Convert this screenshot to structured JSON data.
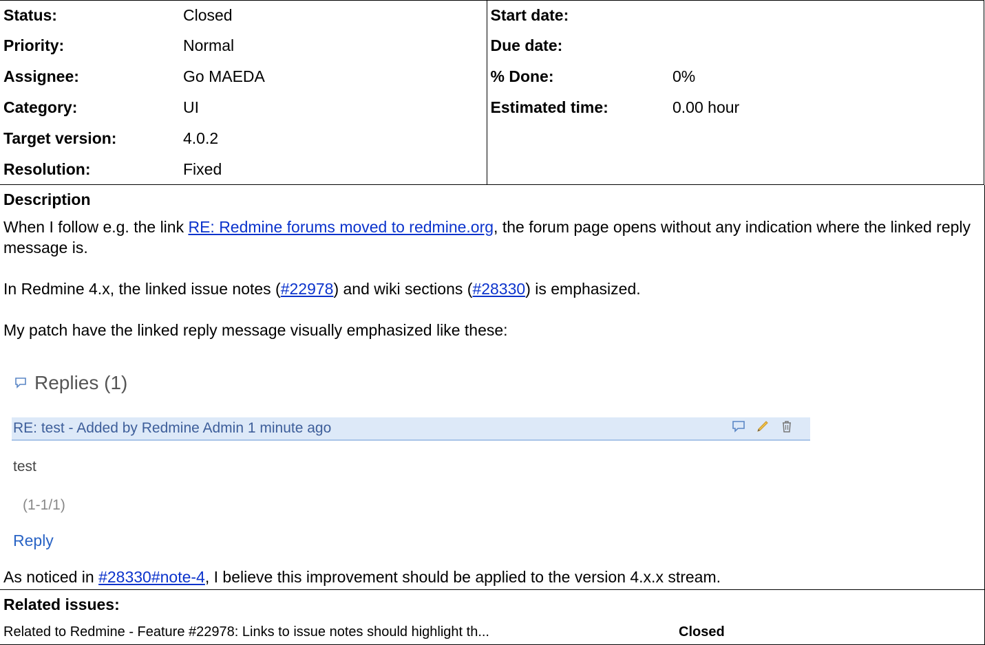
{
  "attributes": {
    "left": [
      {
        "label": "Status:",
        "value": "Closed"
      },
      {
        "label": "Priority:",
        "value": "Normal"
      },
      {
        "label": "Assignee:",
        "value": "Go MAEDA"
      },
      {
        "label": "Category:",
        "value": "UI"
      },
      {
        "label": "Target version:",
        "value": "4.0.2"
      },
      {
        "label": "Resolution:",
        "value": "Fixed"
      }
    ],
    "right": [
      {
        "label": "Start date:",
        "value": ""
      },
      {
        "label": "Due date:",
        "value": ""
      },
      {
        "label": "% Done:",
        "value": "0%"
      },
      {
        "label": "Estimated time:",
        "value": "0.00 hour"
      }
    ]
  },
  "description": {
    "title": "Description",
    "p1_before": "When I follow e.g. the link ",
    "p1_link": "RE: Redmine forums moved to redmine.org",
    "p1_after": ", the forum page opens without any indication where the linked reply message is.",
    "p2_before": "In Redmine 4.x, the linked issue notes (",
    "p2_link1": "#22978",
    "p2_mid": ") and wiki sections (",
    "p2_link2": "#28330",
    "p2_after": ") is emphasized.",
    "p3": "My patch have the linked reply message visually emphasized like these:",
    "p4_before": "As noticed in ",
    "p4_link": "#28330#note-4",
    "p4_after": ", I believe this improvement should be applied to the version 4.x.x stream."
  },
  "screenshot": {
    "title": "Replies (1)",
    "reply_header": "RE: test - Added by Redmine Admin 1 minute ago",
    "reply_body": "test",
    "pager": "(1-1/1)",
    "reply_link": "Reply"
  },
  "related": {
    "title": "Related issues:",
    "items": [
      {
        "text": "Related to Redmine - Feature #22978: Links to issue notes should highlight th...",
        "status": "Closed"
      }
    ]
  }
}
